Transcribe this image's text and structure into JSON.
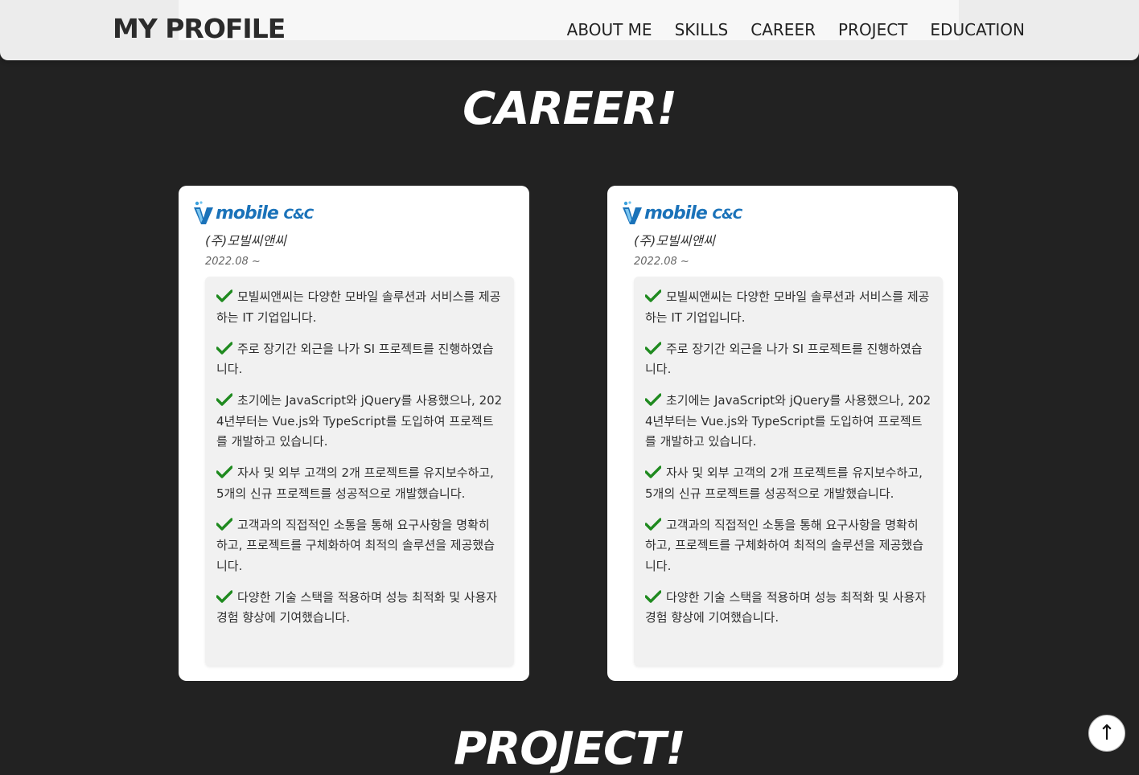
{
  "header": {
    "logo": "MY PROFILE",
    "nav": [
      "ABOUT ME",
      "SKILLS",
      "CAREER",
      "PROJECT",
      "EDUCATION"
    ]
  },
  "career": {
    "title": "CAREER!",
    "cards": [
      {
        "logo_text": "mobile",
        "logo_suffix": "C&C",
        "company": "(주)모빌씨앤씨",
        "period": "2022.08 ~",
        "items": [
          "모빌씨앤씨는 다양한 모바일 솔루션과 서비스를 제공하는 IT 기업입니다.",
          "주로 장기간 외근을 나가 SI 프로젝트를 진행하였습니다.",
          "초기에는 JavaScript와 jQuery를 사용했으나, 2024년부터는 Vue.js와 TypeScript를 도입하여 프로젝트를 개발하고 있습니다.",
          "자사 및 외부 고객의 2개 프로젝트를 유지보수하고, 5개의 신규 프로젝트를 성공적으로 개발했습니다.",
          "고객과의 직접적인 소통을 통해 요구사항을 명확히 하고, 프로젝트를 구체화하여 최적의 솔루션을 제공했습니다.",
          "다양한 기술 스택을 적용하며 성능 최적화 및 사용자 경험 향상에 기여했습니다."
        ]
      },
      {
        "logo_text": "mobile",
        "logo_suffix": "C&C",
        "company": "(주)모빌씨앤씨",
        "period": "2022.08 ~",
        "items": [
          "모빌씨앤씨는 다양한 모바일 솔루션과 서비스를 제공하는 IT 기업입니다.",
          "주로 장기간 외근을 나가 SI 프로젝트를 진행하였습니다.",
          "초기에는 JavaScript와 jQuery를 사용했으나, 2024년부터는 Vue.js와 TypeScript를 도입하여 프로젝트를 개발하고 있습니다.",
          "자사 및 외부 고객의 2개 프로젝트를 유지보수하고, 5개의 신규 프로젝트를 성공적으로 개발했습니다.",
          "고객과의 직접적인 소통을 통해 요구사항을 명확히 하고, 프로젝트를 구체화하여 최적의 솔루션을 제공했습니다.",
          "다양한 기술 스택을 적용하며 성능 최적화 및 사용자 경험 향상에 기여했습니다."
        ]
      }
    ]
  },
  "project": {
    "title": "PROJECT!"
  },
  "scroll_top": {
    "icon": "arrow-up-icon",
    "glyph": "↑"
  },
  "colors": {
    "background": "#222222",
    "header": "#ececec",
    "brand_blue": "#1a72b9",
    "check_green": "#1f8a1f",
    "desc_box": "#f1f1f1"
  }
}
